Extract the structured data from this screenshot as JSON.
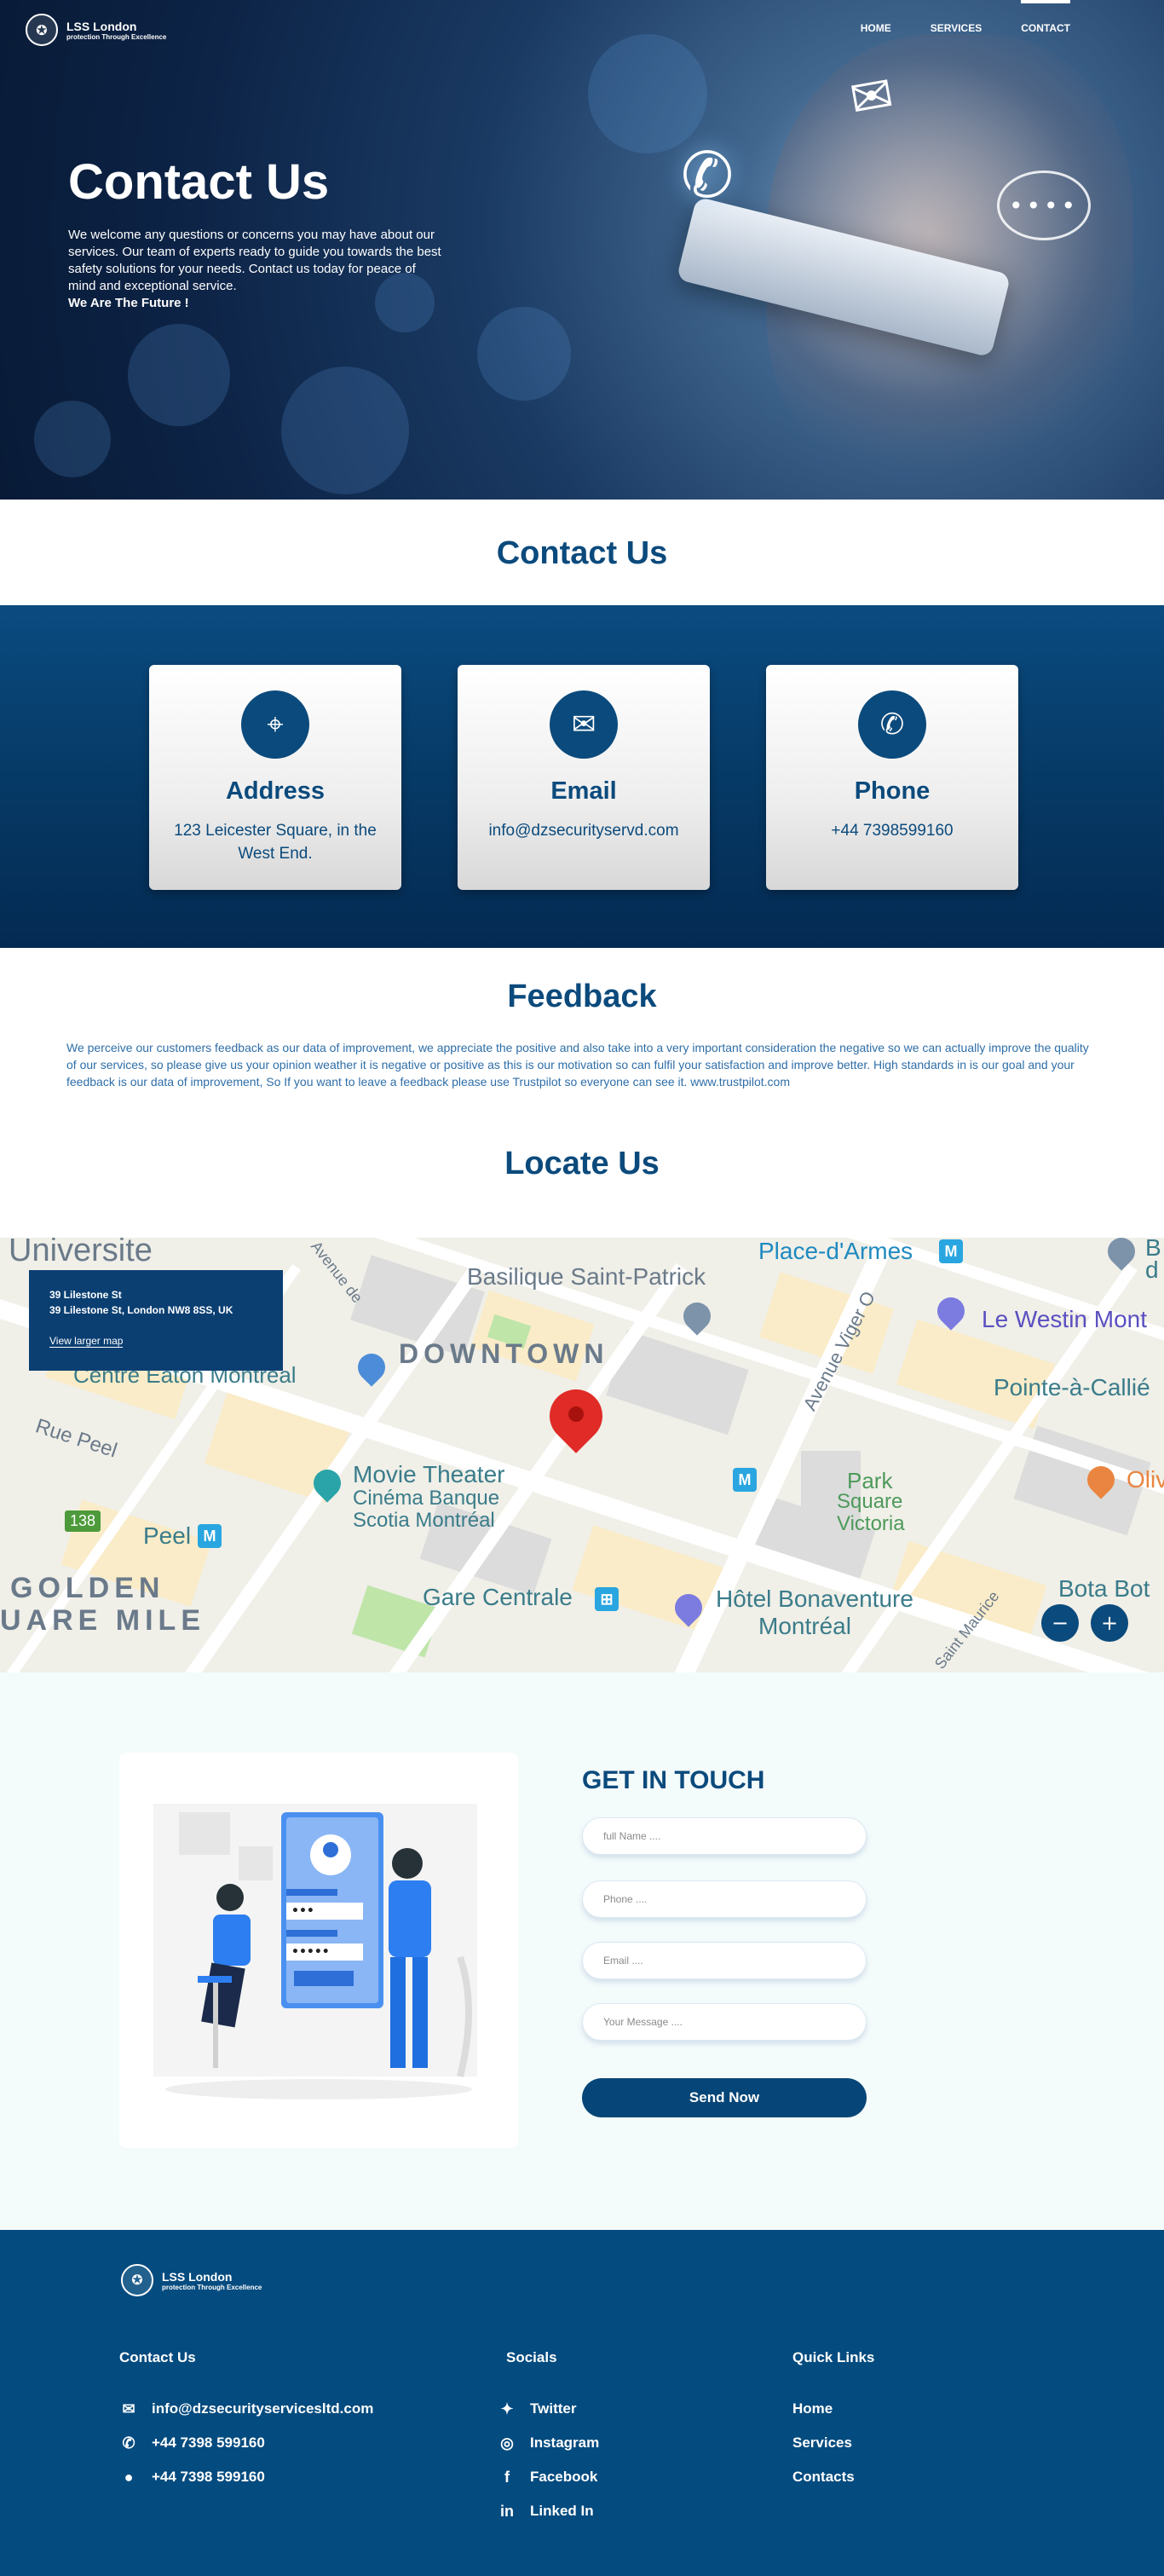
{
  "brand": {
    "name": "LSS London",
    "tagline": "protection Through Excellence"
  },
  "nav": [
    {
      "label": "HOME"
    },
    {
      "label": "SERVICES"
    },
    {
      "label": "CONTACT",
      "active": true
    }
  ],
  "hero": {
    "title": "Contact Us",
    "text": "We welcome any questions or concerns you may have about our services. Our team of experts ready to guide you towards the best safety solutions for your needs. Contact us today for peace of mind and exceptional service.",
    "strong": "We Are The Future !"
  },
  "contact_section": {
    "title": "Contact Us"
  },
  "cards": [
    {
      "icon": "location-icon",
      "title": "Address",
      "value": "123 Leicester Square, in the West End."
    },
    {
      "icon": "email-icon",
      "title": "Email",
      "value": "info@dzsecurityservd.com"
    },
    {
      "icon": "phone-icon",
      "title": "Phone",
      "value": "+44 7398599160"
    }
  ],
  "feedback": {
    "title": "Feedback",
    "text": "We perceive our customers feedback as our data of improvement, we appreciate the positive and also take into a very important consideration the negative so we can actually improve the quality of our services, so please give us your opinion weather it is negative or positive as this is our motivation so can fulfil your satisfaction and improve better. High standards in is our goal and your feedback is our data of improvement, So If you want to leave a feedback please use Trustpilot so everyone can see it. www.trustpilot.com"
  },
  "locate": {
    "title": "Locate Us",
    "info_title": "39 Lilestone St",
    "info_address": "39 Lilestone St, London NW8 8SS, UK",
    "info_link": "View larger map",
    "labels": {
      "universite": "Universite",
      "basilique": "Basilique Saint-Patrick",
      "place_armes": "Place-d'Armes",
      "westin": "Le Westin Mont",
      "pointe": "Pointe-à-Callié",
      "downtown": "DOWNTOWN",
      "centre_eaton": "Centre Eaton Montréal",
      "rue_peel": "Rue Peel",
      "movie": "Movie Theater",
      "cinema": "Cinéma Banque",
      "scotia": "Scotia Montréal",
      "peel": "Peel",
      "park1": "Park",
      "park2": "Square",
      "park3": "Victoria",
      "golden1": "GOLDEN",
      "golden2": "UARE MILE",
      "gare": "Gare Centrale",
      "hotel1": "Hôtel Bonaventure",
      "hotel2": "Montréal",
      "bota": "Bota Bot",
      "route": "138",
      "ave_viger": "Avenue Viger O",
      "ave_de": "Avenue de",
      "saint_maurice": "Saint Maurice",
      "oliv": "Oliv",
      "bd": "B",
      "dd": "d",
      "metro_m": "M"
    },
    "zoom_out": "−",
    "zoom_in": "+"
  },
  "touch": {
    "title": "GET IN TOUCH",
    "fields": [
      {
        "placeholder": "full Name ...."
      },
      {
        "placeholder": "Phone ...."
      },
      {
        "placeholder": "Email ...."
      },
      {
        "placeholder": "Your Message ...."
      }
    ],
    "button": "Send Now",
    "dots_user": "•••",
    "dots_pass": "•••••"
  },
  "footer": {
    "contact_head": "Contact Us",
    "contact": [
      {
        "icon": "envelope-icon",
        "label": "info@dzsecurityservicesltd.com"
      },
      {
        "icon": "phone-icon",
        "label": "+44 7398 599160"
      },
      {
        "icon": "whatsapp-icon",
        "label": "+44 7398 599160"
      }
    ],
    "socials_head": "Socials",
    "socials": [
      {
        "icon": "twitter-icon",
        "label": "Twitter"
      },
      {
        "icon": "instagram-icon",
        "label": "Instagram"
      },
      {
        "icon": "facebook-icon",
        "label": "Facebook"
      },
      {
        "icon": "linkedin-icon",
        "label": "Linked In"
      }
    ],
    "links_head": "Quick Links",
    "links": [
      {
        "label": "Home"
      },
      {
        "label": "Services"
      },
      {
        "label": "Contacts"
      }
    ]
  },
  "colors": {
    "primary": "#0b4a7c",
    "footer": "#044b7f",
    "light_bg": "#f4fbfb",
    "pin": "#e02b26"
  }
}
